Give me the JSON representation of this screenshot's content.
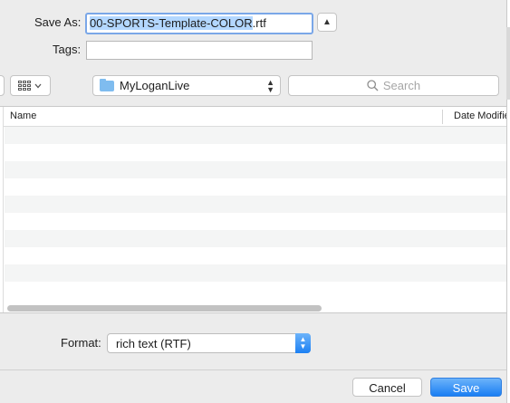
{
  "dialog": {
    "save_as_label": "Save As:",
    "filename_selected": "00-SPORTS-Template-COLOR",
    "filename_extension": ".rtf",
    "tags_label": "Tags:",
    "tags_value": ""
  },
  "toolbar": {
    "location": "MyLoganLive",
    "search_placeholder": "Search"
  },
  "file_list": {
    "columns": [
      "Name",
      "Date Modified"
    ],
    "rows": []
  },
  "format": {
    "label": "Format:",
    "selected": "rich text (RTF)"
  },
  "buttons": {
    "cancel": "Cancel",
    "save": "Save"
  },
  "colors": {
    "accent": "#1d80f3",
    "selection": "#b3d7ff"
  }
}
